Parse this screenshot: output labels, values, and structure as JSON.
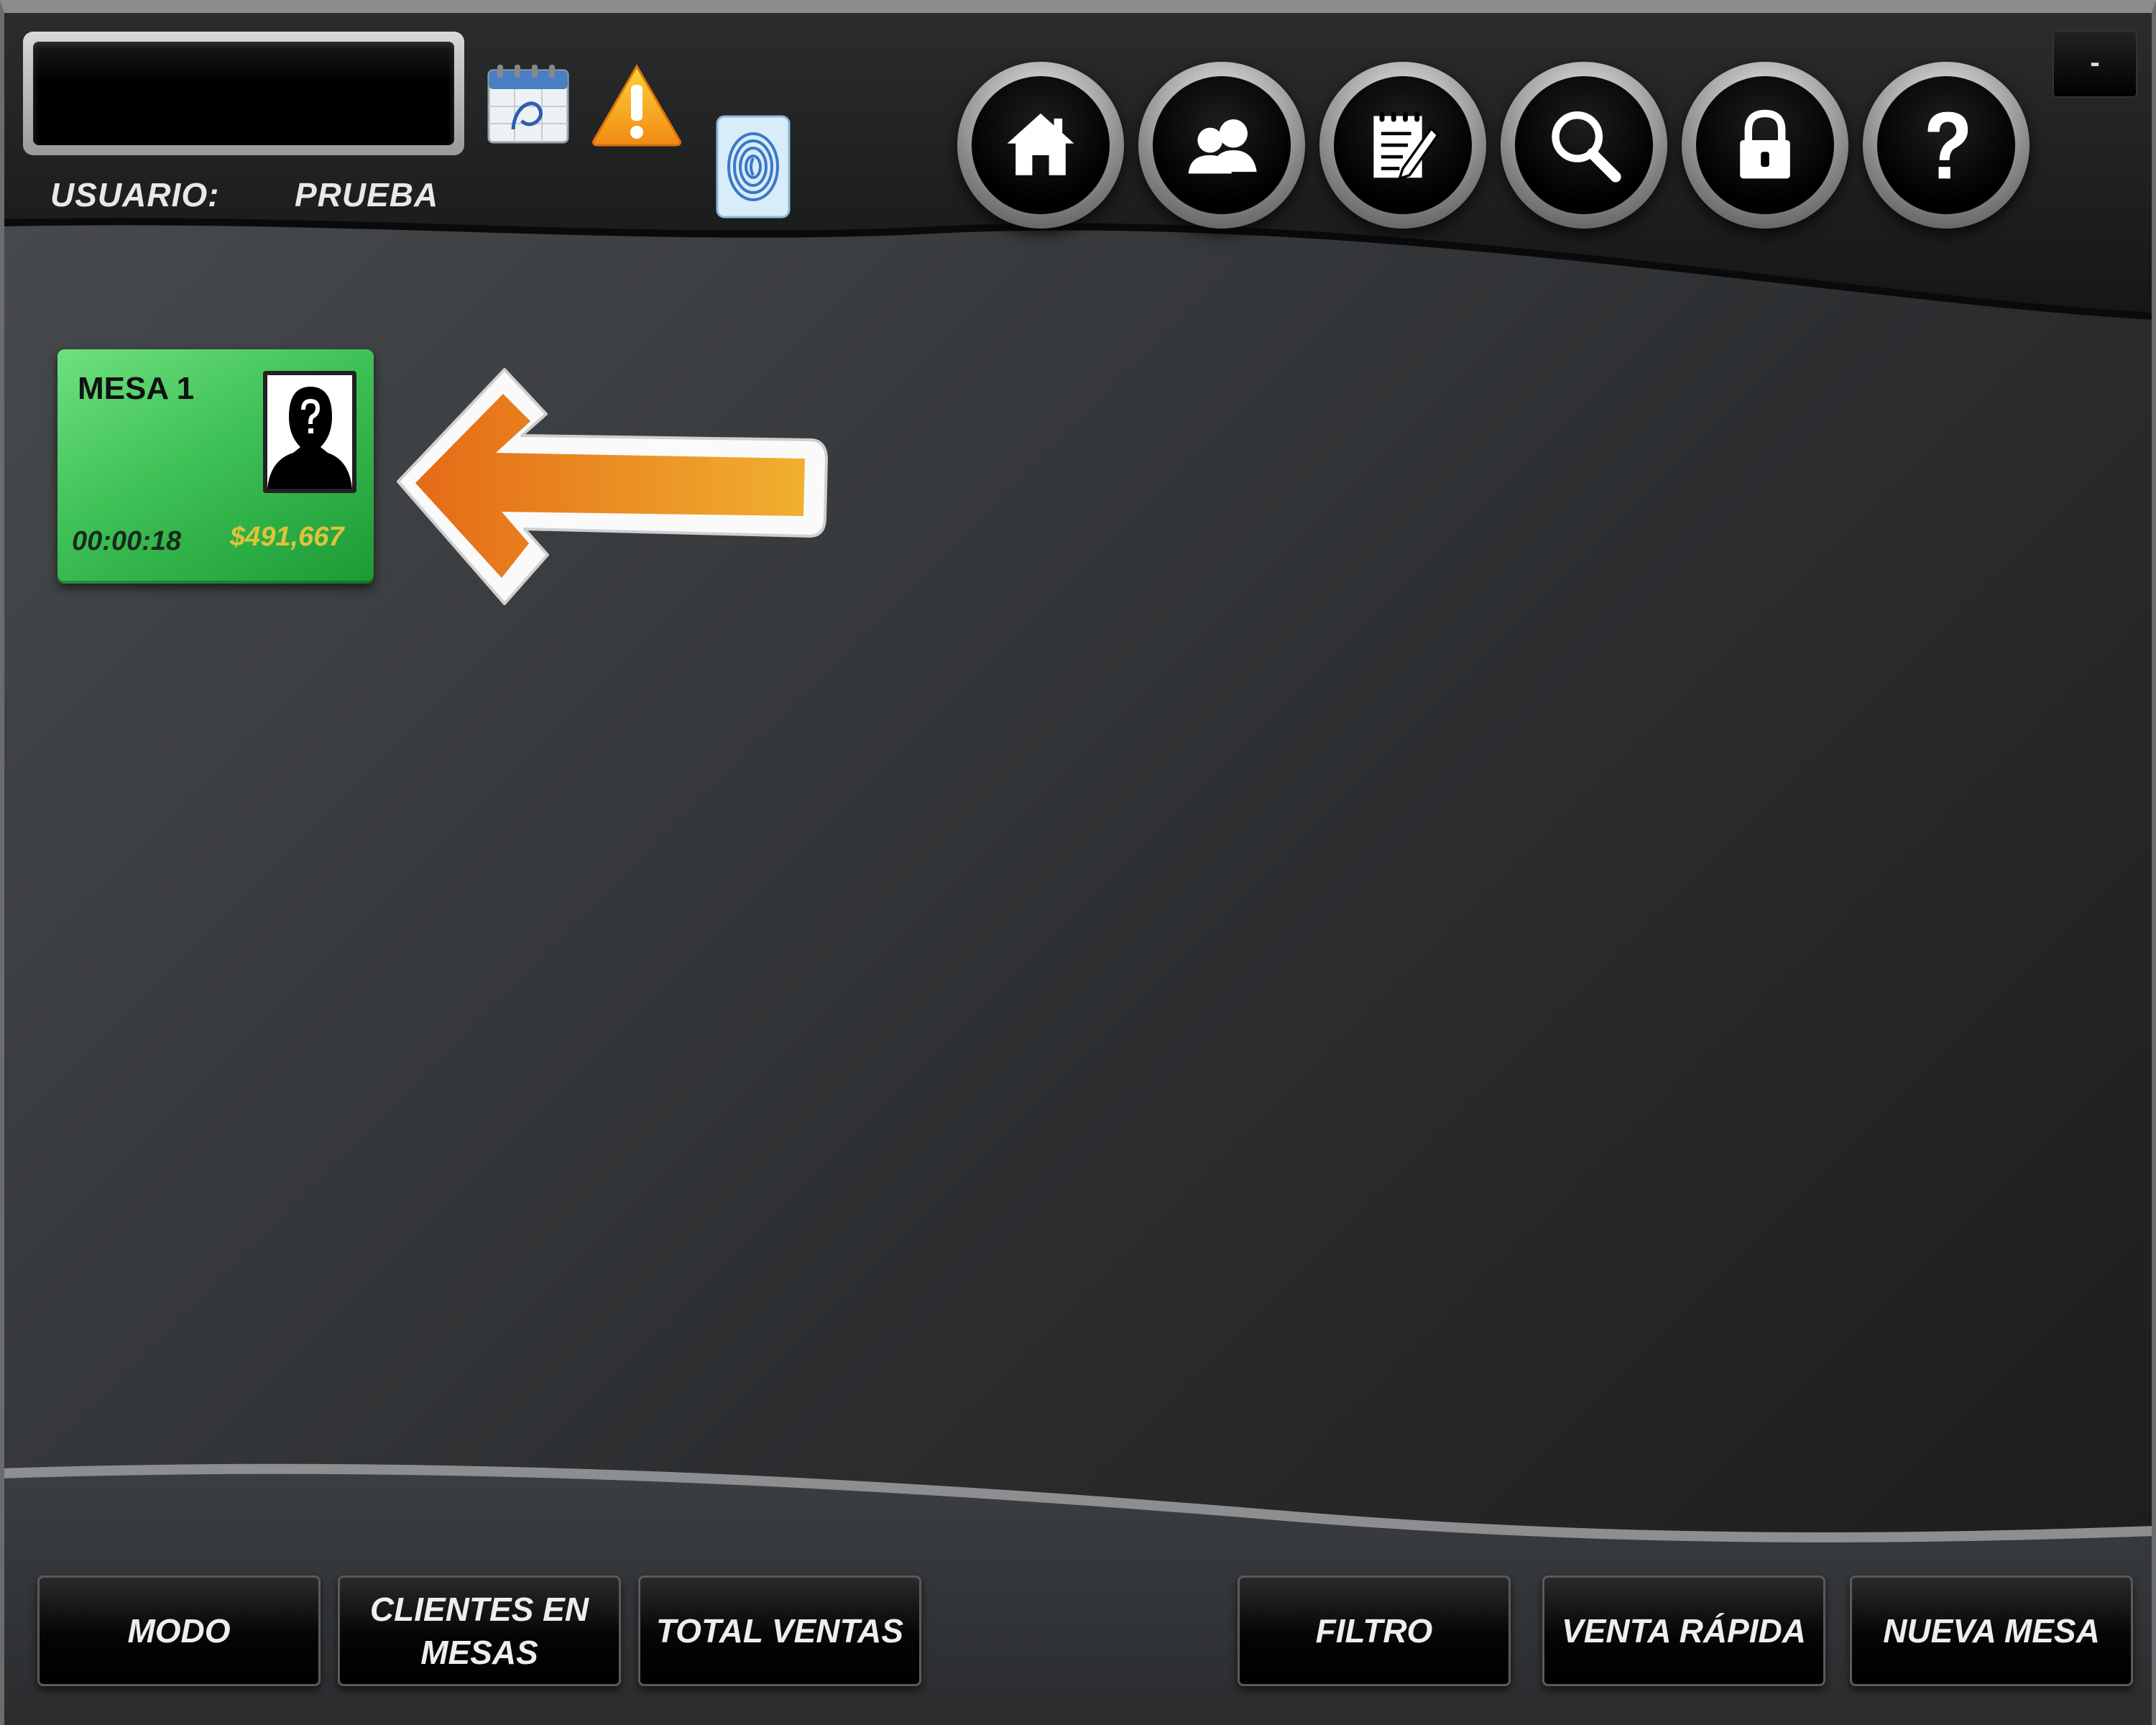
{
  "header": {
    "user_label": "USUARIO:",
    "user_value": "PRUEBA",
    "icons": [
      "calendar-icon",
      "warning-icon",
      "fingerprint-icon"
    ],
    "nav_buttons": [
      "home-icon",
      "users-icon",
      "notepad-icon",
      "search-icon",
      "lock-icon",
      "help-icon"
    ],
    "minimize_label": "-"
  },
  "mesa": {
    "name": "MESA 1",
    "time": "00:00:18",
    "amount": "$491,667",
    "status_color": "#3ec156"
  },
  "footer": {
    "modo": "MODO",
    "clientes": "CLIENTES EN MESAS",
    "total": "TOTAL VENTAS",
    "filtro": "FILTRO",
    "venta_rapida": "VENTA RÁPIDA",
    "nueva_mesa": "NUEVA MESA"
  },
  "colors": {
    "accent_arrow": "#e8831e",
    "card_green": "#3ec156",
    "amount_gold": "#e0c23a"
  }
}
